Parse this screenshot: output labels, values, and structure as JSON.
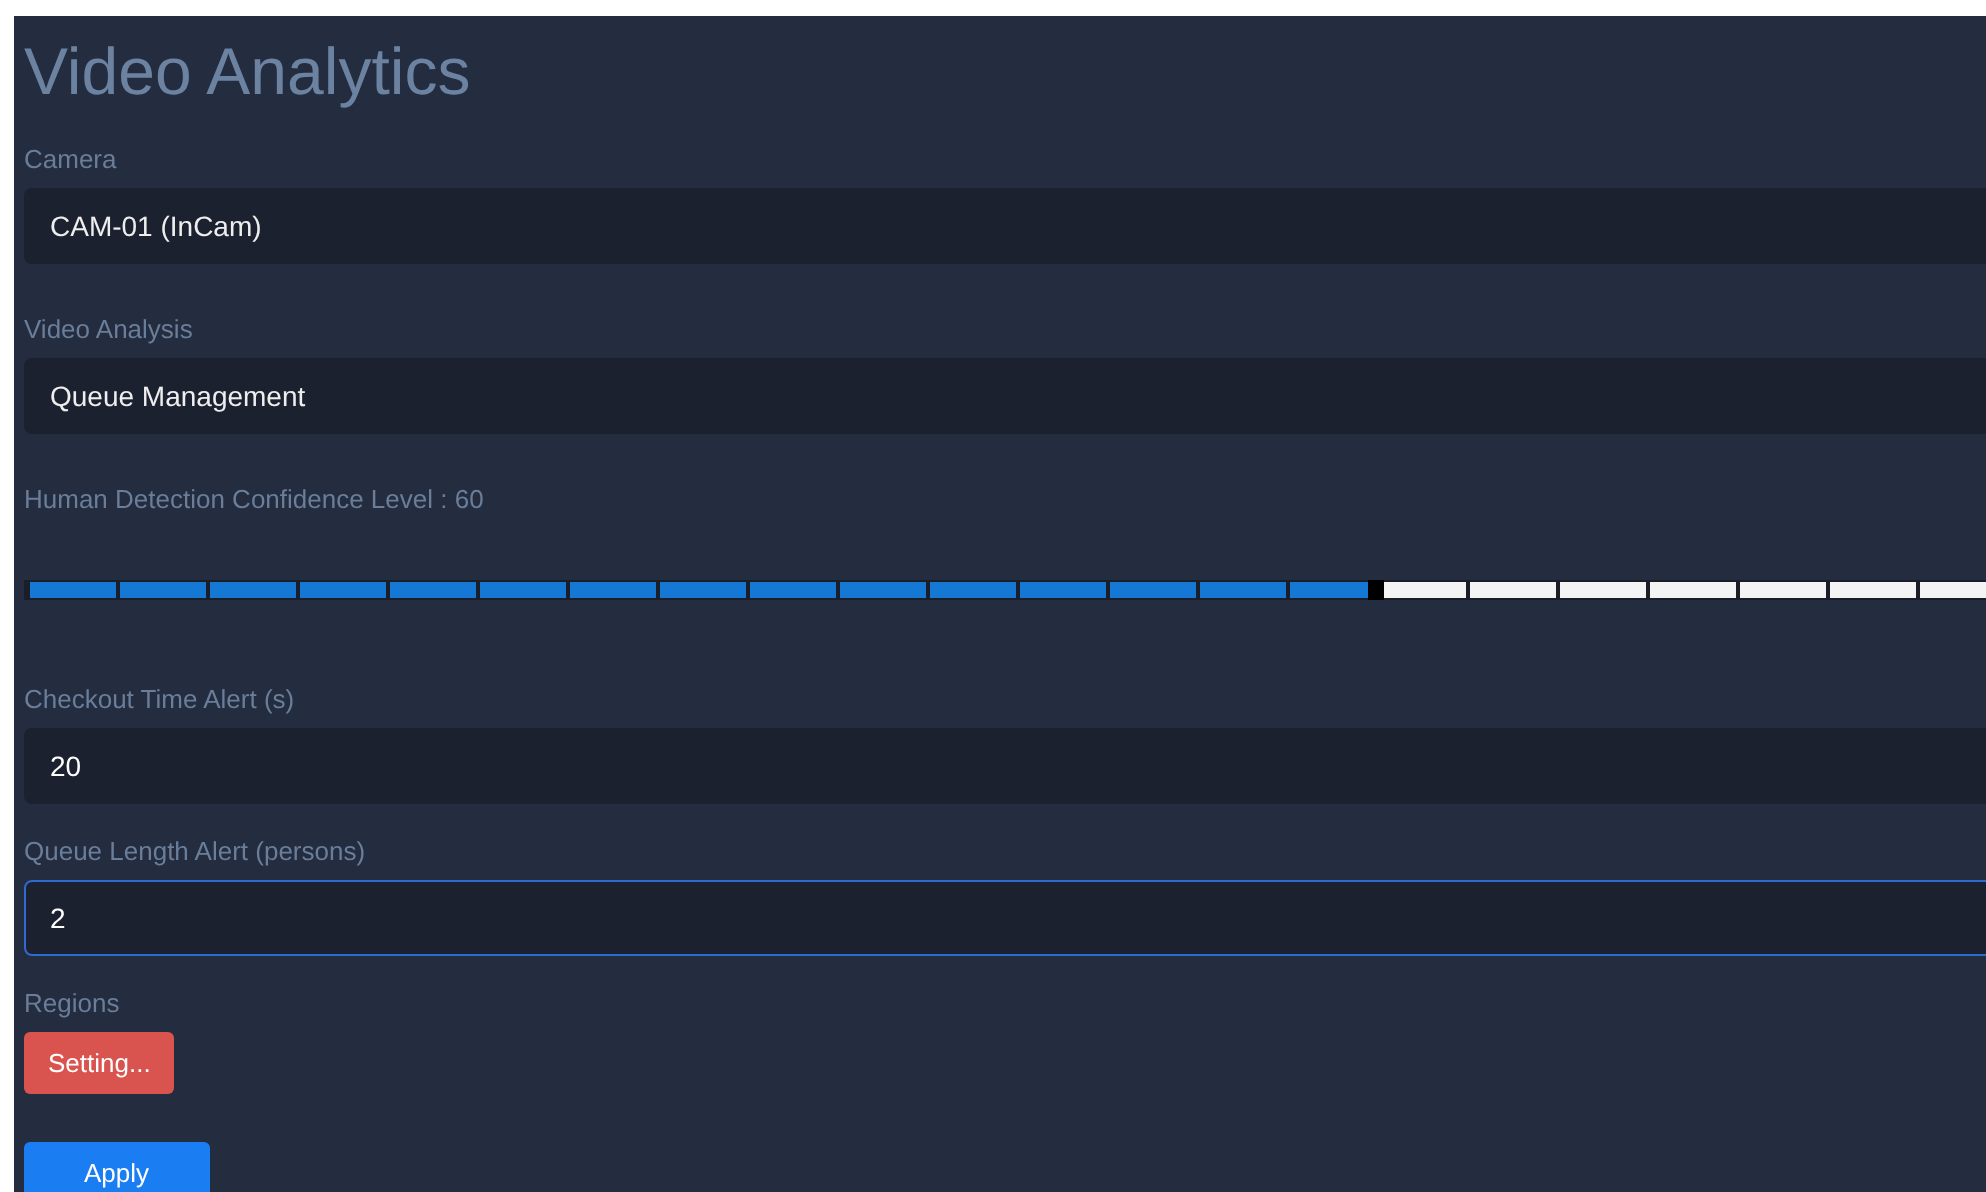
{
  "title": "Video Analytics",
  "fields": [
    {
      "kind": "select",
      "label": "Camera",
      "value": "CAM-01 (InCam)",
      "focused": false
    },
    {
      "kind": "select",
      "label": "Video Analysis",
      "value": "Queue Management",
      "focused": false
    },
    {
      "kind": "slider",
      "label": "Human Detection Confidence Level : 60",
      "level": 0.6
    },
    {
      "kind": "input",
      "label": "Checkout Time Alert (s)",
      "value": "20",
      "focused": false
    },
    {
      "kind": "input",
      "label": "Queue Length Alert (persons)",
      "value": "2",
      "focused": true
    },
    {
      "kind": "button",
      "label": "Regions",
      "button": "Setting..."
    }
  ],
  "apply": "Apply"
}
